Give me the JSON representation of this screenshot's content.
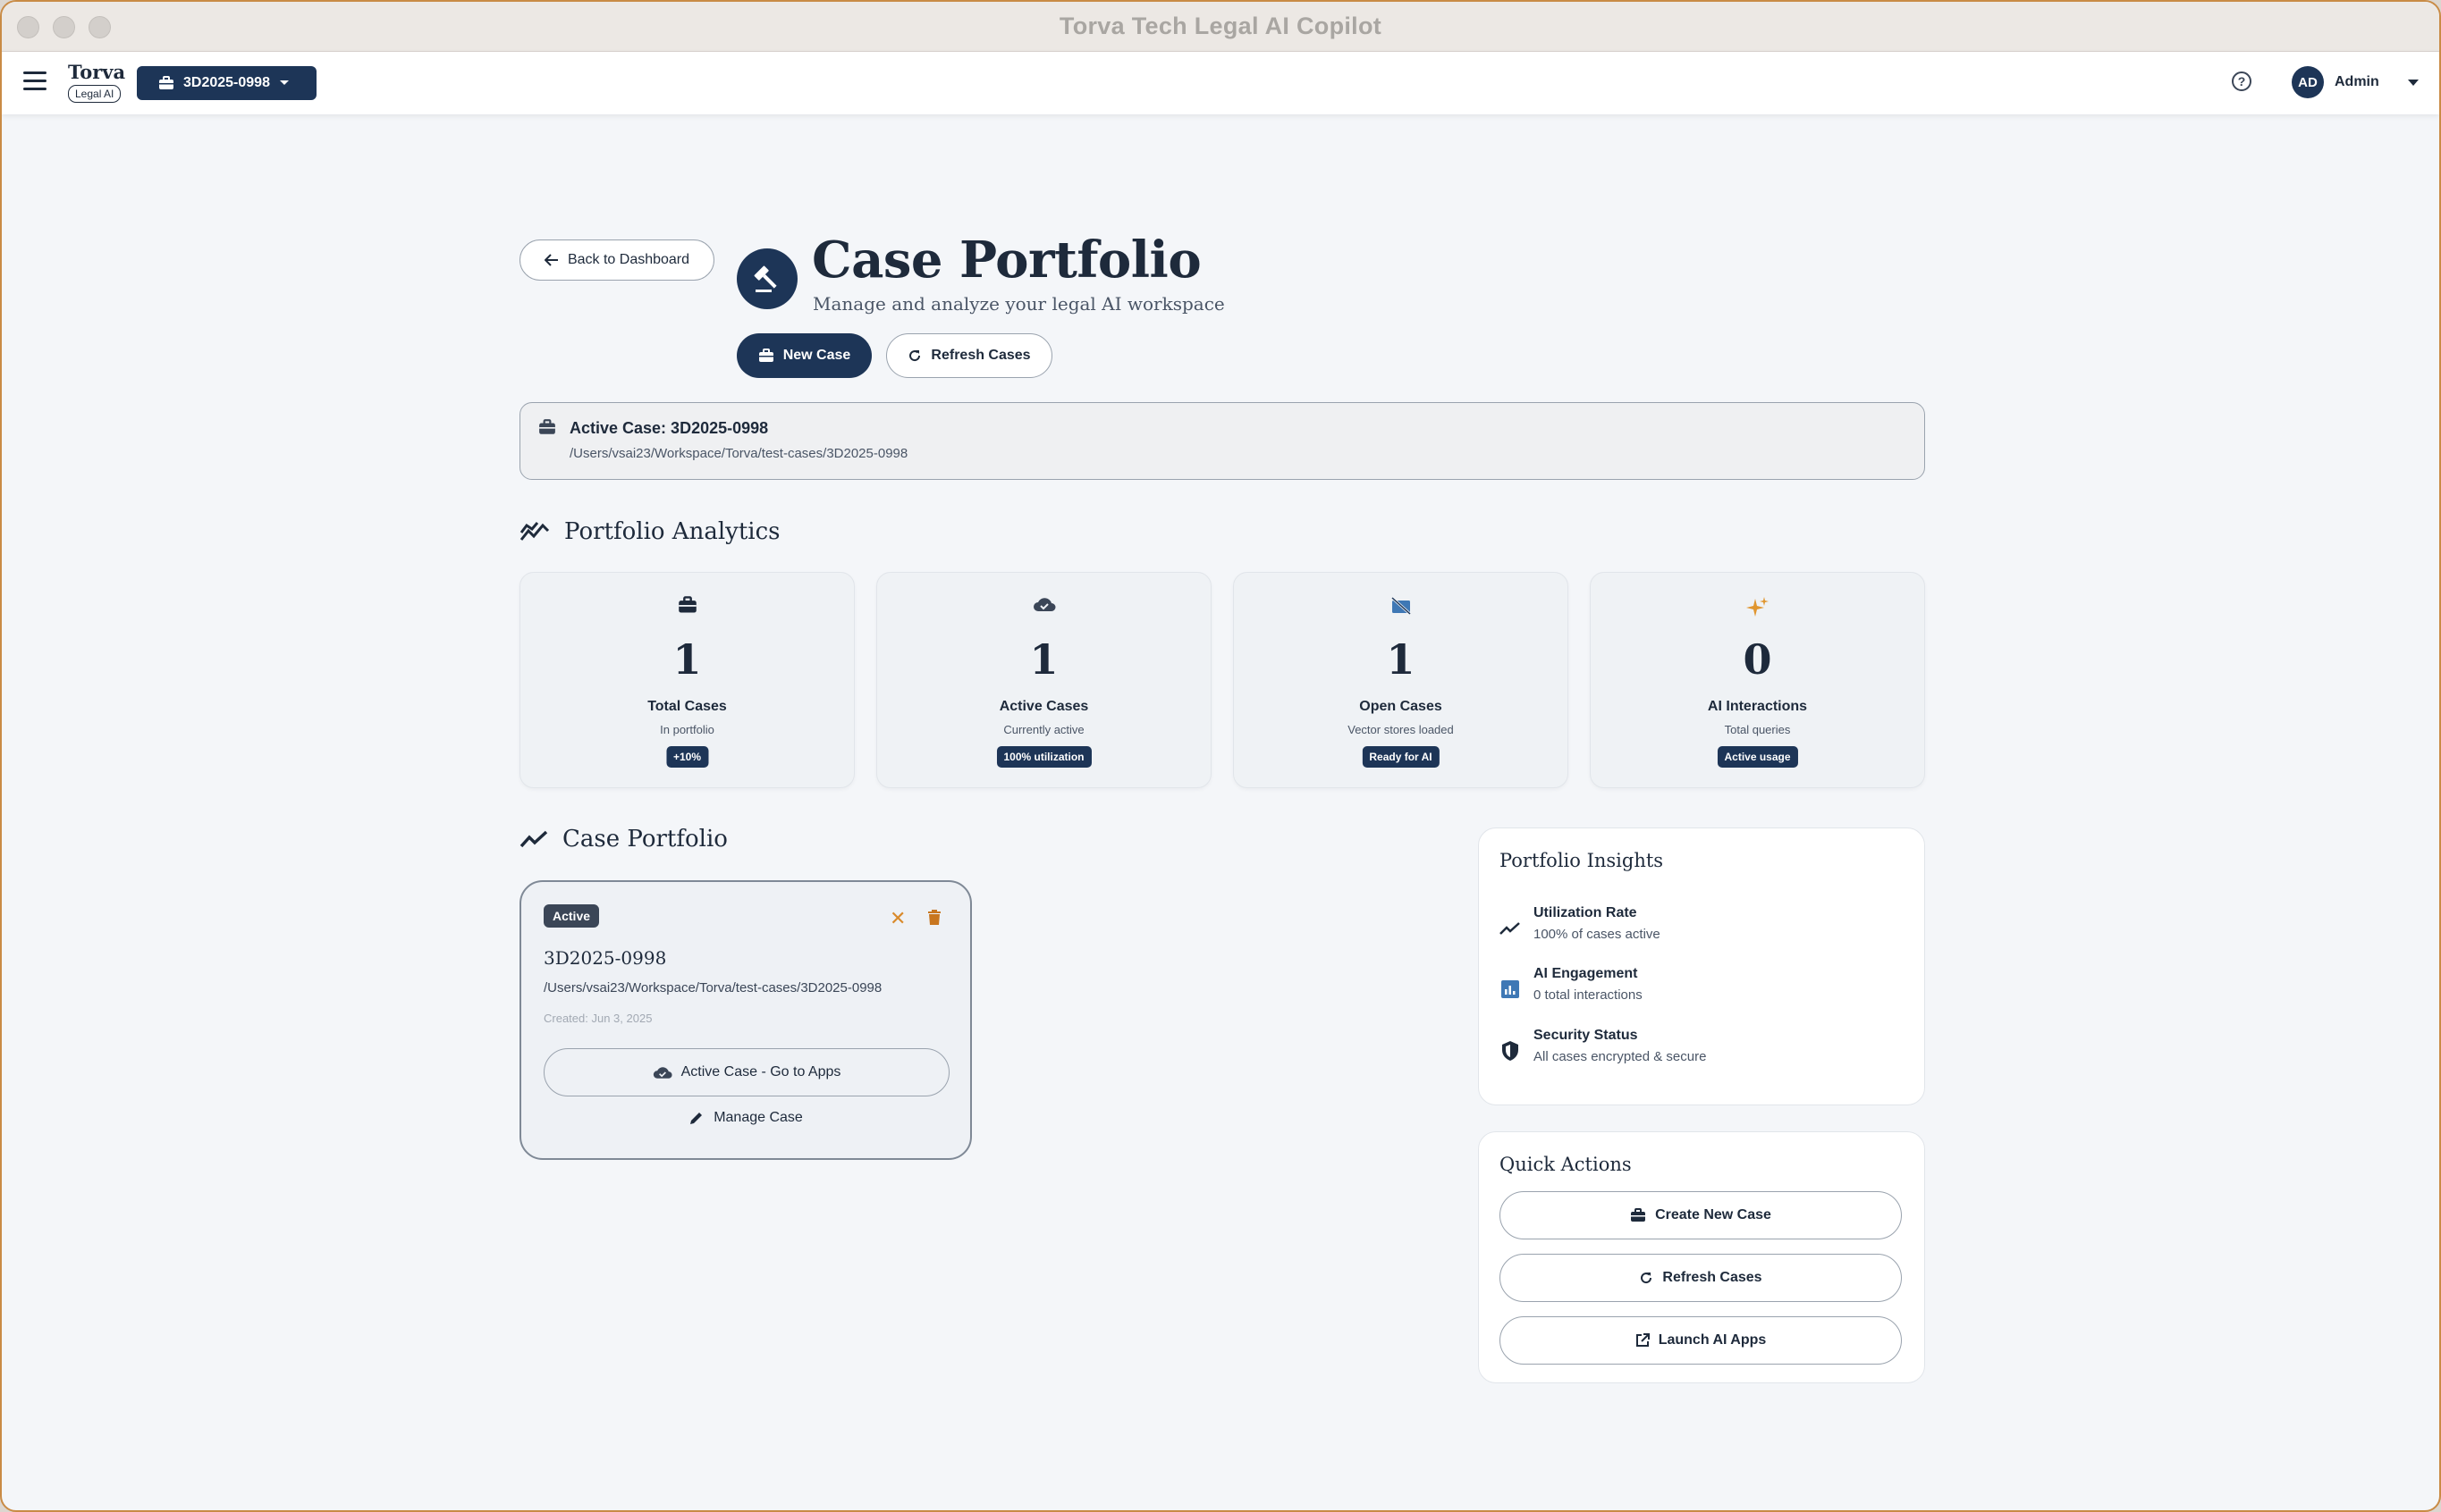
{
  "window": {
    "title": "Torva Tech Legal AI Copilot"
  },
  "appbar": {
    "brand_name": "Torva",
    "brand_badge": "Legal AI",
    "case_selector": "3D2025-0998",
    "user_initials": "AD",
    "user_name": "Admin",
    "help_glyph": "?"
  },
  "header": {
    "back_label": "Back to Dashboard",
    "title": "Case Portfolio",
    "subtitle": "Manage and analyze your legal AI workspace",
    "new_case_label": "New Case",
    "refresh_label": "Refresh Cases"
  },
  "active_case": {
    "title": "Active Case: 3D2025-0998",
    "path": "/Users/vsai23/Workspace/Torva/test-cases/3D2025-0998"
  },
  "analytics": {
    "heading": "Portfolio Analytics",
    "cards": [
      {
        "icon": "briefcase-icon",
        "value": "1",
        "label": "Total Cases",
        "sub": "In portfolio",
        "badge": "+10%"
      },
      {
        "icon": "cloud-done-icon",
        "value": "1",
        "label": "Active Cases",
        "sub": "Currently active",
        "badge": "100% utilization"
      },
      {
        "icon": "folder-off-icon",
        "value": "1",
        "label": "Open Cases",
        "sub": "Vector stores loaded",
        "badge": "Ready for AI"
      },
      {
        "icon": "sparkle-icon",
        "value": "0",
        "label": "AI Interactions",
        "sub": "Total queries",
        "badge": "Active usage"
      }
    ]
  },
  "portfolio": {
    "heading": "Case Portfolio",
    "case": {
      "status": "Active",
      "name": "3D2025-0998",
      "path": "/Users/vsai23/Workspace/Torva/test-cases/3D2025-0998",
      "created": "Created: Jun 3, 2025",
      "go_label": "Active Case - Go to Apps",
      "manage_label": "Manage Case",
      "close_glyph": "✕"
    }
  },
  "insights": {
    "title": "Portfolio Insights",
    "items": [
      {
        "icon": "trending-up-icon",
        "title": "Utilization Rate",
        "sub": "100% of cases active"
      },
      {
        "icon": "analytics-icon",
        "title": "AI Engagement",
        "sub": "0 total interactions"
      },
      {
        "icon": "shield-icon",
        "title": "Security Status",
        "sub": "All cases encrypted & secure"
      }
    ]
  },
  "quick_actions": {
    "title": "Quick Actions",
    "create_label": "Create New Case",
    "refresh_label": "Refresh Cases",
    "launch_label": "Launch AI Apps"
  },
  "colors": {
    "primary": "#1d3557",
    "accent": "#d98a2b",
    "background": "#f4f6f9"
  }
}
